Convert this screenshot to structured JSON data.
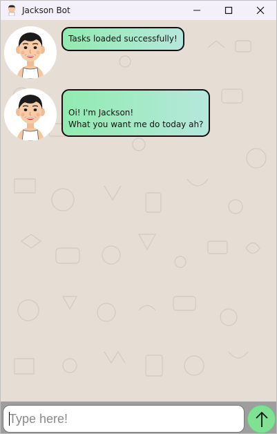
{
  "window": {
    "title": "Jackson Bot",
    "controls": [
      "minimize-icon",
      "maximize-icon",
      "close-icon"
    ]
  },
  "messages": [
    {
      "sender": "bot",
      "avatar": "boy-avatar",
      "text": "Tasks loaded successfully!"
    },
    {
      "sender": "bot",
      "avatar": "boy-avatar",
      "text": "Oi! I'm Jackson!\nWhat you want me do today ah?"
    }
  ],
  "input": {
    "placeholder": "Type here!",
    "value": ""
  },
  "send_button": {
    "icon": "arrow-up-icon"
  },
  "colors": {
    "chat_background": "#e6ddd4",
    "bubble_start": "#91ebb0",
    "bubble_end": "#b5e8dc",
    "send_button": "#7fe192",
    "input_bar": "#9e9e9e"
  }
}
